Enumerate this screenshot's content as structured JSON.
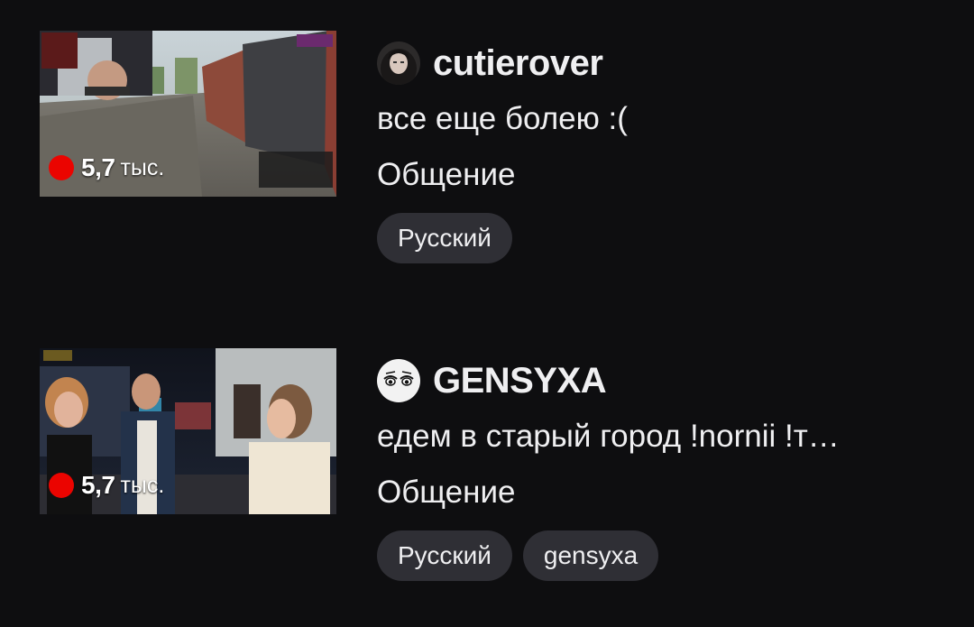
{
  "streams": [
    {
      "channel": "cutierover",
      "title": "все еще болею :(",
      "category": "Общение",
      "viewers": "5,7",
      "viewers_unit": "тыс.",
      "tags": [
        "Русский"
      ],
      "avatar_icon": "dark-haired-girl-avatar-icon"
    },
    {
      "channel": "GENSYXA",
      "title": "едем в старый город !nornii !т…",
      "category": "Общение",
      "viewers": "5,7",
      "viewers_unit": "тыс.",
      "tags": [
        "Русский",
        "gensyxa"
      ],
      "avatar_icon": "anime-eyes-avatar-icon"
    }
  ],
  "colors": {
    "background": "#0e0e10",
    "text": "#efeff1",
    "tag_background": "#2f2f35",
    "live_red": "#eb0400"
  }
}
